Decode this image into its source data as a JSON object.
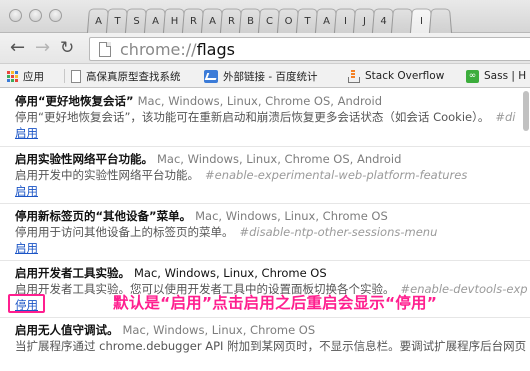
{
  "tabs": [
    "A",
    "T",
    "S",
    "A",
    "H",
    "R",
    "A",
    "R",
    "B",
    "C",
    "O",
    "T",
    "A",
    "I",
    "J",
    "4",
    "",
    "I",
    ""
  ],
  "toolbar": {
    "url_scheme": "chrome://",
    "url_path": "flags"
  },
  "bookmarks": [
    {
      "label": "应用",
      "icon": "apps-icon"
    },
    {
      "label": "高保真原型查找系统",
      "icon": "page-icon"
    },
    {
      "label": "外部链接 - 百度统计",
      "icon": "stats-icon"
    },
    {
      "label": "Stack Overflow",
      "icon": "stackoverflow-icon"
    },
    {
      "label": "Sass | H",
      "icon": "sass-icon"
    }
  ],
  "experiments": [
    {
      "name": "停用“更好地恢复会话”",
      "platforms": "Mac, Windows, Linux, Chrome OS, Android",
      "description": "停用“更好地恢复会话”，该功能可在重新启动和崩溃后恢复更多会话状态（如会话 Cookie）。",
      "anchor": "#di",
      "action": "启用"
    },
    {
      "name": "启用实验性网络平台功能。",
      "platforms": "Mac, Windows, Linux, Chrome OS, Android",
      "description": "启用开发中的实验性网络平台功能。",
      "anchor": "#enable-experimental-web-platform-features",
      "action": "启用"
    },
    {
      "name": "停用新标签页的“其他设备”菜单。",
      "platforms": "Mac, Windows, Linux, Chrome OS",
      "description": "停用用于访问其他设备上的标签页的菜单。",
      "anchor": "#disable-ntp-other-sessions-menu",
      "action": "启用"
    },
    {
      "name": "启用开发者工具实验。",
      "platforms": "Mac, Windows, Linux, Chrome OS",
      "description": "启用开发者工具实验。您可以使用开发者工具中的设置面板切换各个实验。",
      "anchor": "#enable-devtools-exp",
      "action": "停用"
    },
    {
      "name": "启用无人值守调试。",
      "platforms": "Mac, Windows, Linux, Chrome OS",
      "description": "当扩展程序通过 chrome.debugger API 附加到某网页时，不显示信息栏。要调试扩展程序后台网页",
      "anchor": "",
      "action": ""
    }
  ],
  "annotation": "默认是“启用”点击启用之后重启会显示“停用”",
  "colors": {
    "link": "#1a54c6",
    "annotation": "#ff1f8f"
  }
}
